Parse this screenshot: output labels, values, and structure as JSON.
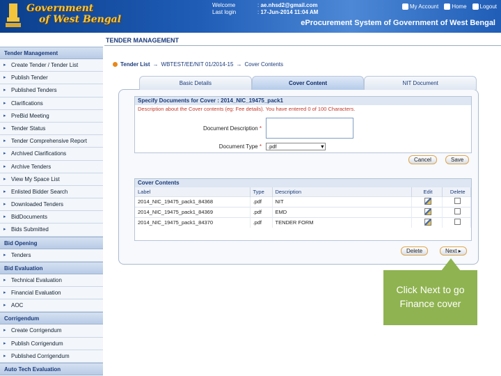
{
  "header": {
    "logo_line1": "Government",
    "logo_line2": "of West Bengal",
    "welcome_label": "Welcome",
    "welcome_value": "ae.nhsd2@gmail.com",
    "lastlogin_label": "Last login",
    "lastlogin_value": "17-Jun-2014 11:04 AM",
    "nav": {
      "account": "My Account",
      "home": "Home",
      "logout": "Logout"
    },
    "system_title": "eProcurement System of Government of West Bengal"
  },
  "page_title": "TENDER MANAGEMENT",
  "sidebar": {
    "sections": [
      {
        "title": "Tender Management",
        "items": [
          "Create Tender / Tender List",
          "Publish Tender",
          "Published Tenders",
          "Clarifications",
          "PreBid Meeting",
          "Tender Status",
          "Tender Comprehensive Report",
          "Archived Clarifications",
          "Archive Tenders",
          "View My Space List",
          "Enlisted Bidder Search",
          "Downloaded Tenders",
          "BidDocuments",
          "Bids Submitted"
        ]
      },
      {
        "title": "Bid Opening",
        "items": [
          "Tenders"
        ]
      },
      {
        "title": "Bid Evaluation",
        "items": [
          "Technical Evaluation",
          "Financial Evaluation",
          "AOC"
        ]
      },
      {
        "title": "Corrigendum",
        "items": [
          "Create Corrigendum",
          "Publish Corrigendum",
          "Published Corrigendum"
        ]
      },
      {
        "title": "Auto Tech Evaluation",
        "items": []
      }
    ]
  },
  "breadcrumb": {
    "root": "Tender List",
    "ref": "WBTEST/EE/NIT 01/2014-15",
    "current": "Cover Contents"
  },
  "tabs": [
    "Basic Details",
    "Cover Content",
    "NIT Document"
  ],
  "spec": {
    "heading": "Specify Documents for Cover : 2014_NIC_19475_pack1",
    "hint": "Description about the Cover contents (eg: Fee details). You have entered 0 of 100 Characters.",
    "desc_label": "Document Description",
    "type_label": "Document Type",
    "type_value": ".pdf"
  },
  "buttons": {
    "cancel": "Cancel",
    "save": "Save",
    "delete": "Delete",
    "next": "Next"
  },
  "cover": {
    "heading": "Cover Contents",
    "columns": [
      "Label",
      "Type",
      "Description",
      "Edit",
      "Delete"
    ],
    "rows": [
      {
        "label": "2014_NIC_19475_pack1_84368",
        "type": ".pdf",
        "desc": "NIT"
      },
      {
        "label": "2014_NIC_19475_pack1_84369",
        "type": ".pdf",
        "desc": "EMD"
      },
      {
        "label": "2014_NIC_19475_pack1_84370",
        "type": ".pdf",
        "desc": "TENDER FORM"
      }
    ]
  },
  "callout": "Click Next to go Finance cover",
  "colors": {
    "header": "#1f5db7",
    "callout": "#8fb350",
    "accent": "#e8881a"
  }
}
